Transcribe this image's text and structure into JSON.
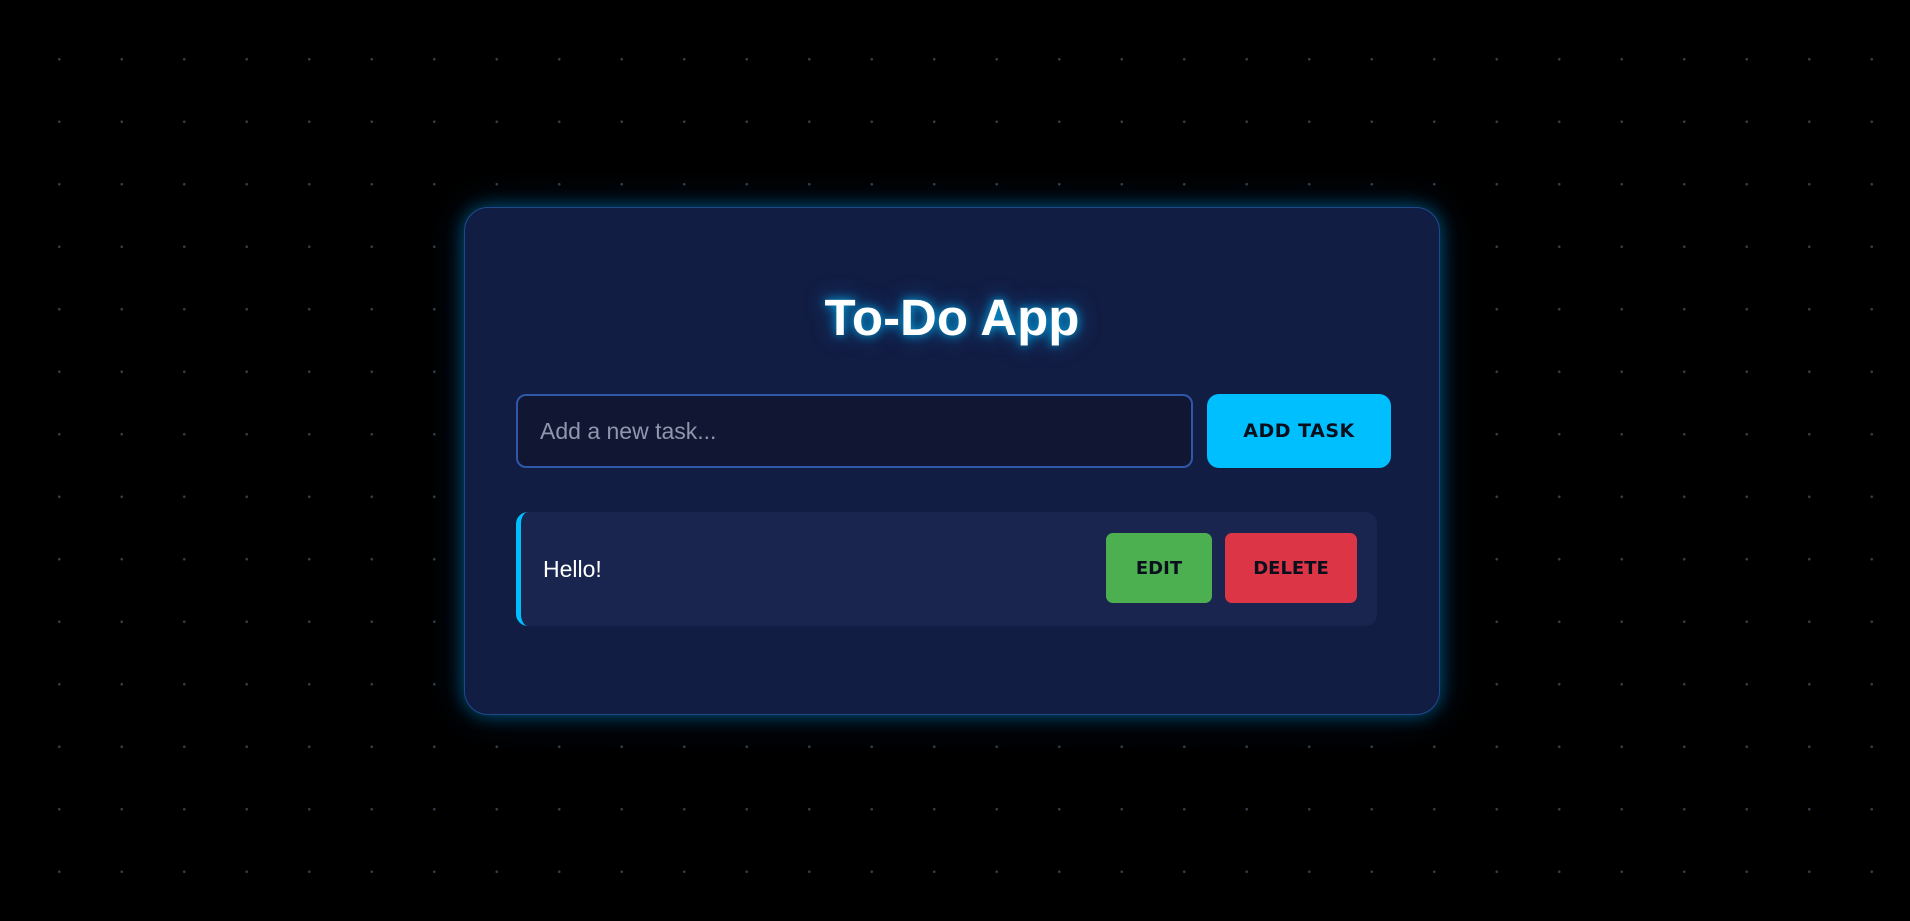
{
  "app": {
    "title": "To-Do App"
  },
  "input": {
    "value": "",
    "placeholder": "Add a new task..."
  },
  "add_button": {
    "label": "ADD TASK"
  },
  "tasks": [
    {
      "text": "Hello!",
      "edit_label": "EDIT",
      "delete_label": "DELETE"
    }
  ],
  "colors": {
    "accent": "#00bfff",
    "edit": "#4caf50",
    "delete": "#dc3545",
    "card_background": "#121d43",
    "page_background": "#000000"
  }
}
